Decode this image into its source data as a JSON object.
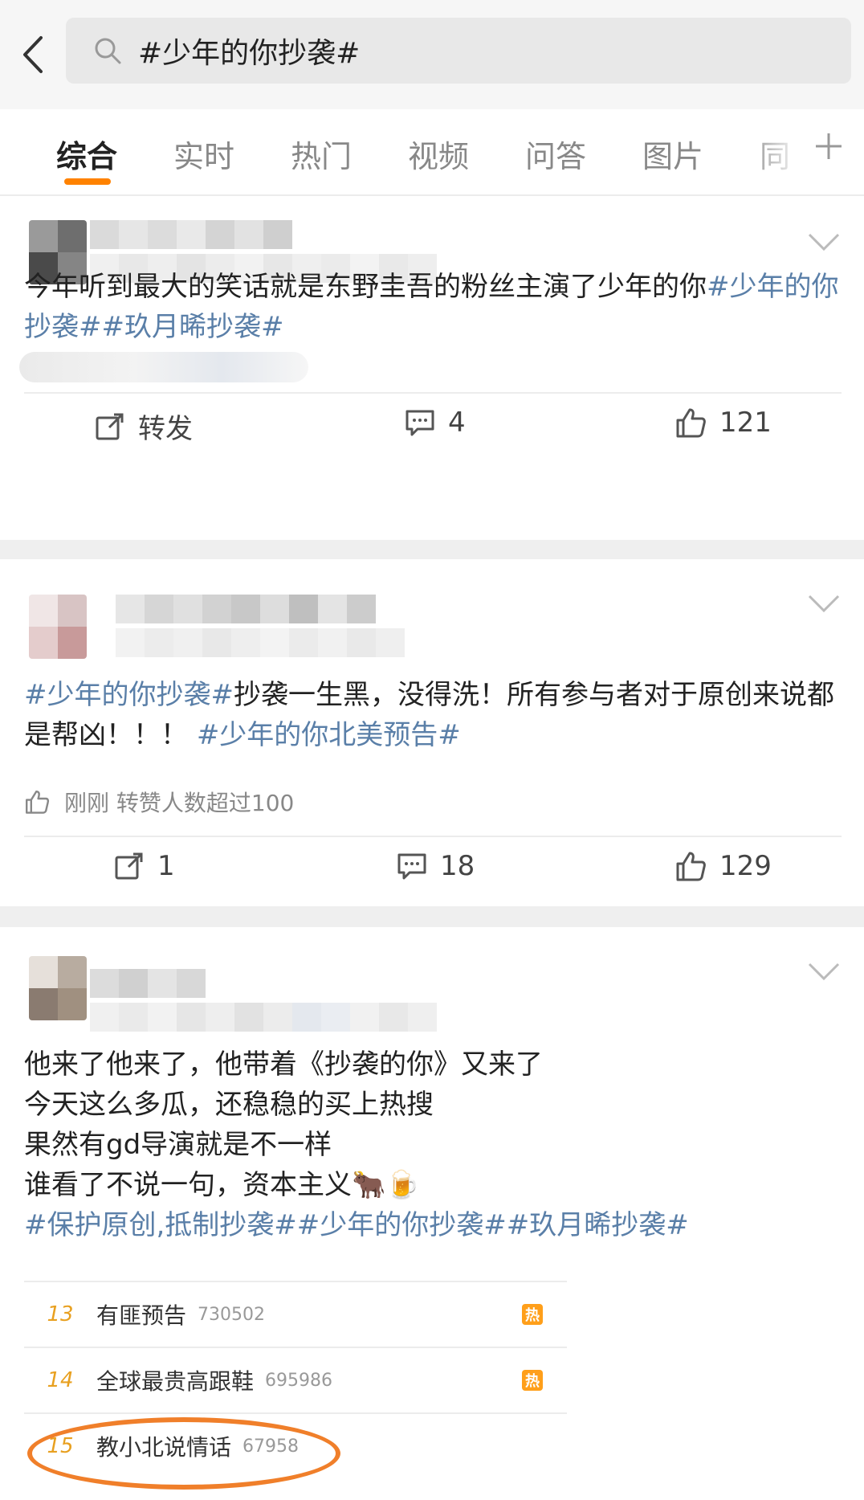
{
  "search": {
    "query": "#少年的你抄袭#"
  },
  "tabs": [
    "综合",
    "实时",
    "热门",
    "视频",
    "问答",
    "图片",
    "同"
  ],
  "posts": [
    {
      "text": "今年听到最大的笑话就是东野圭吾的粉丝主演了少年的你",
      "tags_inline": "#少年的你抄袭##玖月晞抄袭#",
      "actions": {
        "repost": "转发",
        "comments": "4",
        "likes": "121"
      }
    },
    {
      "tag_lead": "#少年的你抄袭#",
      "text_a": "抄袭一生黑，没得洗！所有参与者对于原创来说都是帮凶！！！ ",
      "tag_trail": "#少年的你北美预告#",
      "meta": "刚刚 转赞人数超过100",
      "actions": {
        "repost": "1",
        "comments": "18",
        "likes": "129"
      }
    },
    {
      "lines": [
        "他来了他来了，他带着《抄袭的你》又来了",
        "今天这么多瓜，还稳稳的买上热搜",
        "果然有gd导演就是不一样",
        "谁看了不说一句，资本主义🐂🍺"
      ],
      "tags": "#保护原创,抵制抄袭##少年的你抄袭##玖月晞抄袭#",
      "hotlist": [
        {
          "rank": "13",
          "title": "有匪预告",
          "count": "730502",
          "badge": "热"
        },
        {
          "rank": "14",
          "title": "全球最贵高跟鞋",
          "count": "695986",
          "badge": "热"
        },
        {
          "rank": "15",
          "title": "教小北说情话",
          "count": "67958",
          "badge": ""
        }
      ]
    }
  ],
  "colors": {
    "accent": "#ff8200",
    "link": "#5a7fa8",
    "circle": "#f07f2a"
  }
}
